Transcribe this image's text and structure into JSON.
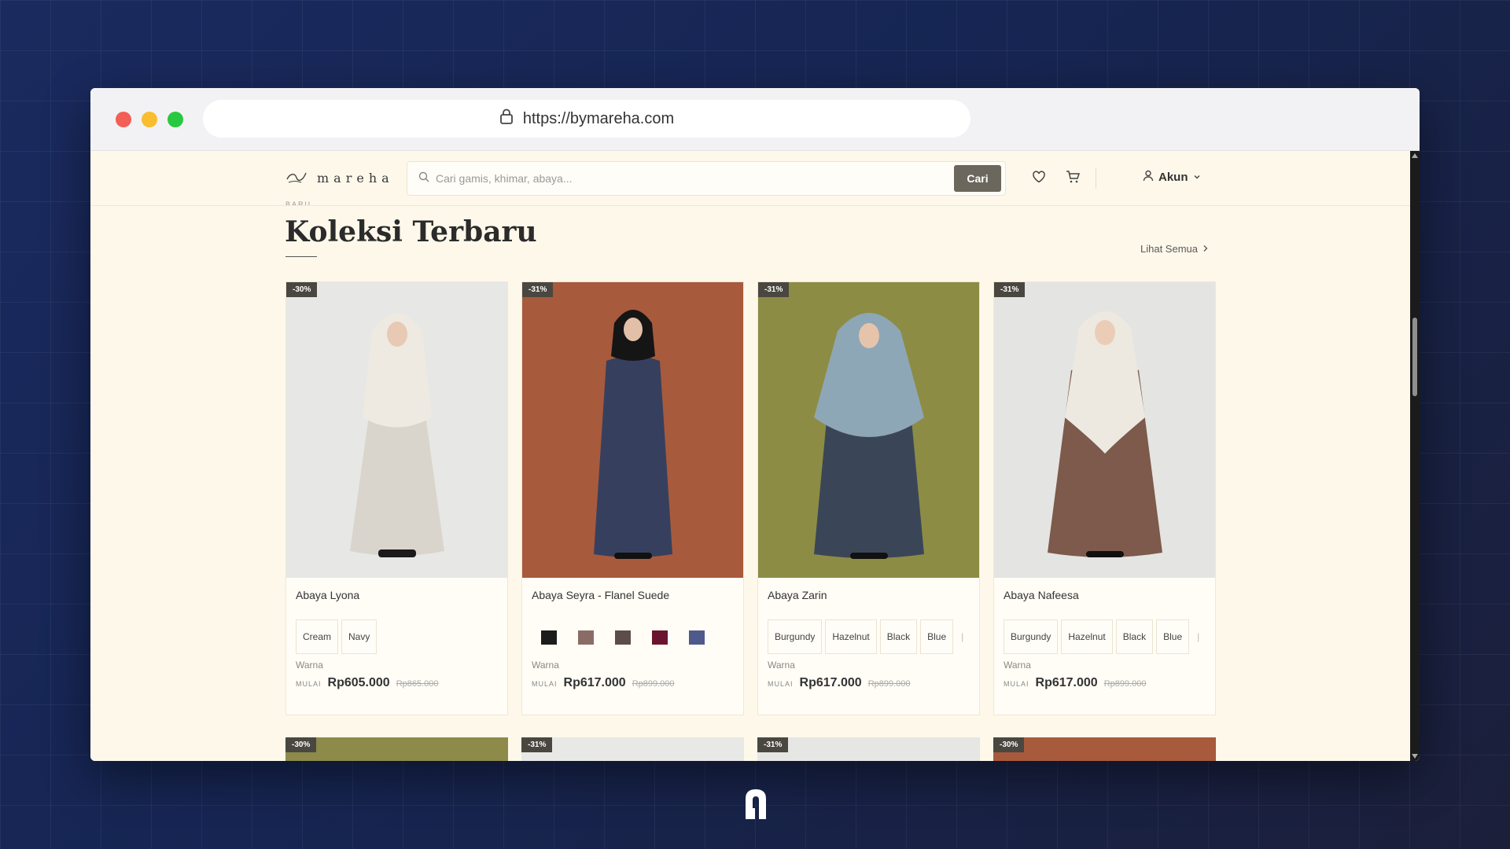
{
  "browser": {
    "url": "https://bymareha.com"
  },
  "site": {
    "logo_text": "mareha",
    "search_placeholder": "Cari gamis, khimar, abaya...",
    "search_button": "Cari",
    "account_label": "Akun"
  },
  "section": {
    "eyebrow": "BARU",
    "title": "Koleksi Terbaru",
    "see_all": "Lihat Semua"
  },
  "products": [
    {
      "badge": "-30%",
      "name": "Abaya Lyona",
      "chips": [
        "Cream",
        "Navy"
      ],
      "color_label": "Warna",
      "from_label": "MULAI",
      "price": "Rp605.000",
      "old_price": "Rp865.000",
      "bg_color": "#e7e7e5",
      "dress_color": "#d9d5cc",
      "hijab_color": "#eeeae2"
    },
    {
      "badge": "-31%",
      "name": "Abaya Seyra - Flanel Suede",
      "swatches": [
        "#1c1c1c",
        "#8a6c66",
        "#5d4c4c",
        "#6b1430",
        "#4e5a8c"
      ],
      "color_label": "Warna",
      "from_label": "MULAI",
      "price": "Rp617.000",
      "old_price": "Rp899.000",
      "bg_color": "#a85a3c",
      "dress_color": "#36405e",
      "hijab_color": "#151515"
    },
    {
      "badge": "-31%",
      "name": "Abaya Zarin",
      "chips": [
        "Burgundy",
        "Hazelnut",
        "Black",
        "Blue"
      ],
      "more": "|",
      "color_label": "Warna",
      "from_label": "MULAI",
      "price": "Rp617.000",
      "old_price": "Rp899.000",
      "bg_color": "#8d8c45",
      "dress_color": "#3a4658",
      "hijab_color": "#8ea7b6"
    },
    {
      "badge": "-31%",
      "name": "Abaya Nafeesa",
      "chips": [
        "Burgundy",
        "Hazelnut",
        "Black",
        "Blue"
      ],
      "more": "|",
      "color_label": "Warna",
      "from_label": "MULAI",
      "price": "Rp617.000",
      "old_price": "Rp899.000",
      "bg_color": "#e4e4e2",
      "dress_color": "#7d5a4c",
      "hijab_color": "#ede9e1"
    }
  ],
  "next_row_badges": [
    "-30%",
    "-31%",
    "-31%",
    "-30%"
  ]
}
